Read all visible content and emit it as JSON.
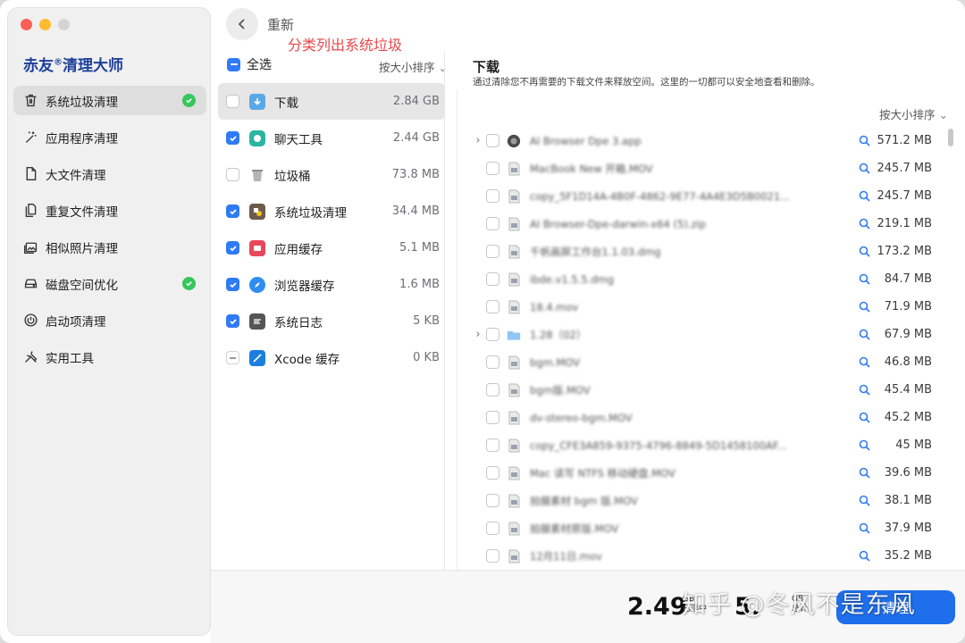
{
  "app": {
    "brand": "赤友",
    "brand_mark": "®",
    "brand_suffix": "清理大师"
  },
  "sidebar": {
    "items": [
      {
        "label": "系统垃圾清理",
        "icon": "trash-icon",
        "active": true,
        "checked": true
      },
      {
        "label": "应用程序清理",
        "icon": "magic-wand-icon",
        "active": false,
        "checked": false
      },
      {
        "label": "大文件清理",
        "icon": "document-icon",
        "active": false,
        "checked": false
      },
      {
        "label": "重复文件清理",
        "icon": "duplicate-files-icon",
        "active": false,
        "checked": false
      },
      {
        "label": "相似照片清理",
        "icon": "photos-icon",
        "active": false,
        "checked": false
      },
      {
        "label": "磁盘空间优化",
        "icon": "disk-icon",
        "active": false,
        "checked": true
      },
      {
        "label": "启动项清理",
        "icon": "power-icon",
        "active": false,
        "checked": false
      },
      {
        "label": "实用工具",
        "icon": "tools-icon",
        "active": false,
        "checked": false
      }
    ]
  },
  "header": {
    "back_icon": "chevron-left-icon",
    "rescan_label": "重新",
    "annotation": "分类列出系统垃圾"
  },
  "categories": {
    "select_all_label": "全选",
    "sort_label": "按大小排序",
    "items": [
      {
        "label": "下载",
        "size": "2.84 GB",
        "state": "unchecked",
        "icon": "download-folder-icon",
        "color": "#5aa9e6",
        "active": true
      },
      {
        "label": "聊天工具",
        "size": "2.44 GB",
        "state": "checked",
        "icon": "chat-icon",
        "color": "#2bb5a0",
        "active": false
      },
      {
        "label": "垃圾桶",
        "size": "73.8 MB",
        "state": "unchecked",
        "icon": "trash-bin-icon",
        "color": "#a9a9a9",
        "active": false
      },
      {
        "label": "系统垃圾清理",
        "size": "34.4 MB",
        "state": "checked",
        "icon": "system-junk-icon",
        "color": "#6b5b4b",
        "active": false
      },
      {
        "label": "应用缓存",
        "size": "5.1 MB",
        "state": "checked",
        "icon": "app-cache-icon",
        "color": "#e8485a",
        "active": false
      },
      {
        "label": "浏览器缓存",
        "size": "1.6 MB",
        "state": "checked",
        "icon": "browser-icon",
        "color": "#2f8ef0",
        "active": false
      },
      {
        "label": "系统日志",
        "size": "5 KB",
        "state": "checked",
        "icon": "log-icon",
        "color": "#555555",
        "active": false
      },
      {
        "label": "Xcode 缓存",
        "size": "0 KB",
        "state": "mixed",
        "icon": "xcode-icon",
        "color": "#1c7fe0",
        "active": false
      }
    ]
  },
  "detail": {
    "title": "下载",
    "description": "通过清除您不再需要的下载文件来释放空间。这里的一切都可以安全地查看和删除。",
    "sort_label": "按大小排序",
    "files": [
      {
        "name": "AI Browser Dpe 3.app",
        "size": "571.2 MB",
        "expandable": true,
        "type": "app"
      },
      {
        "name": "MacBook New 开箱.MOV",
        "size": "245.7 MB",
        "expandable": false,
        "type": "file"
      },
      {
        "name": "copy_5F1D14A-4B0F-4862-9E77-4A4E3D5B0021...",
        "size": "245.7 MB",
        "expandable": false,
        "type": "file"
      },
      {
        "name": "AI Browser-Dpe-darwin-x64 (5).zip",
        "size": "219.1 MB",
        "expandable": false,
        "type": "file"
      },
      {
        "name": "千帆画屏工作台1.1.03.dmg",
        "size": "173.2 MB",
        "expandable": false,
        "type": "file"
      },
      {
        "name": "ibde.v1.5.5.dmg",
        "size": "84.7 MB",
        "expandable": false,
        "type": "file"
      },
      {
        "name": "18.4.mov",
        "size": "71.9 MB",
        "expandable": false,
        "type": "file"
      },
      {
        "name": "1.28（02）",
        "size": "67.9 MB",
        "expandable": true,
        "type": "folder"
      },
      {
        "name": "bgm.MOV",
        "size": "46.8 MB",
        "expandable": false,
        "type": "file"
      },
      {
        "name": "bgm版.MOV",
        "size": "45.4 MB",
        "expandable": false,
        "type": "file"
      },
      {
        "name": "dv-stereo-bgm.MOV",
        "size": "45.2 MB",
        "expandable": false,
        "type": "file"
      },
      {
        "name": "copy_CFE3A859-9375-4796-8849-5D1458100AF...",
        "size": "45 MB",
        "expandable": false,
        "type": "file"
      },
      {
        "name": "Mac 读写 NTFS 移动硬盘.MOV",
        "size": "39.6 MB",
        "expandable": false,
        "type": "file"
      },
      {
        "name": "拍摄素材 bgm 版.MOV",
        "size": "38.1 MB",
        "expandable": false,
        "type": "file"
      },
      {
        "name": "拍摄素材原版.MOV",
        "size": "37.9 MB",
        "expandable": false,
        "type": "file"
      },
      {
        "name": "12月11日.mov",
        "size": "35.2 MB",
        "expandable": false,
        "type": "file"
      }
    ]
  },
  "footer": {
    "selected_size": "2.49",
    "selected_unit": "GB",
    "selected_caption": "已选中",
    "disk_size": "5.",
    "disk_unit": "GB",
    "disk_caption": "总计",
    "clean_button": "清理"
  },
  "watermark": "知乎 @冬风不是东风",
  "colors": {
    "accent": "#2f7bf6",
    "success": "#34c759",
    "annotation": "#e8474a",
    "brand": "#1d3f9a"
  }
}
